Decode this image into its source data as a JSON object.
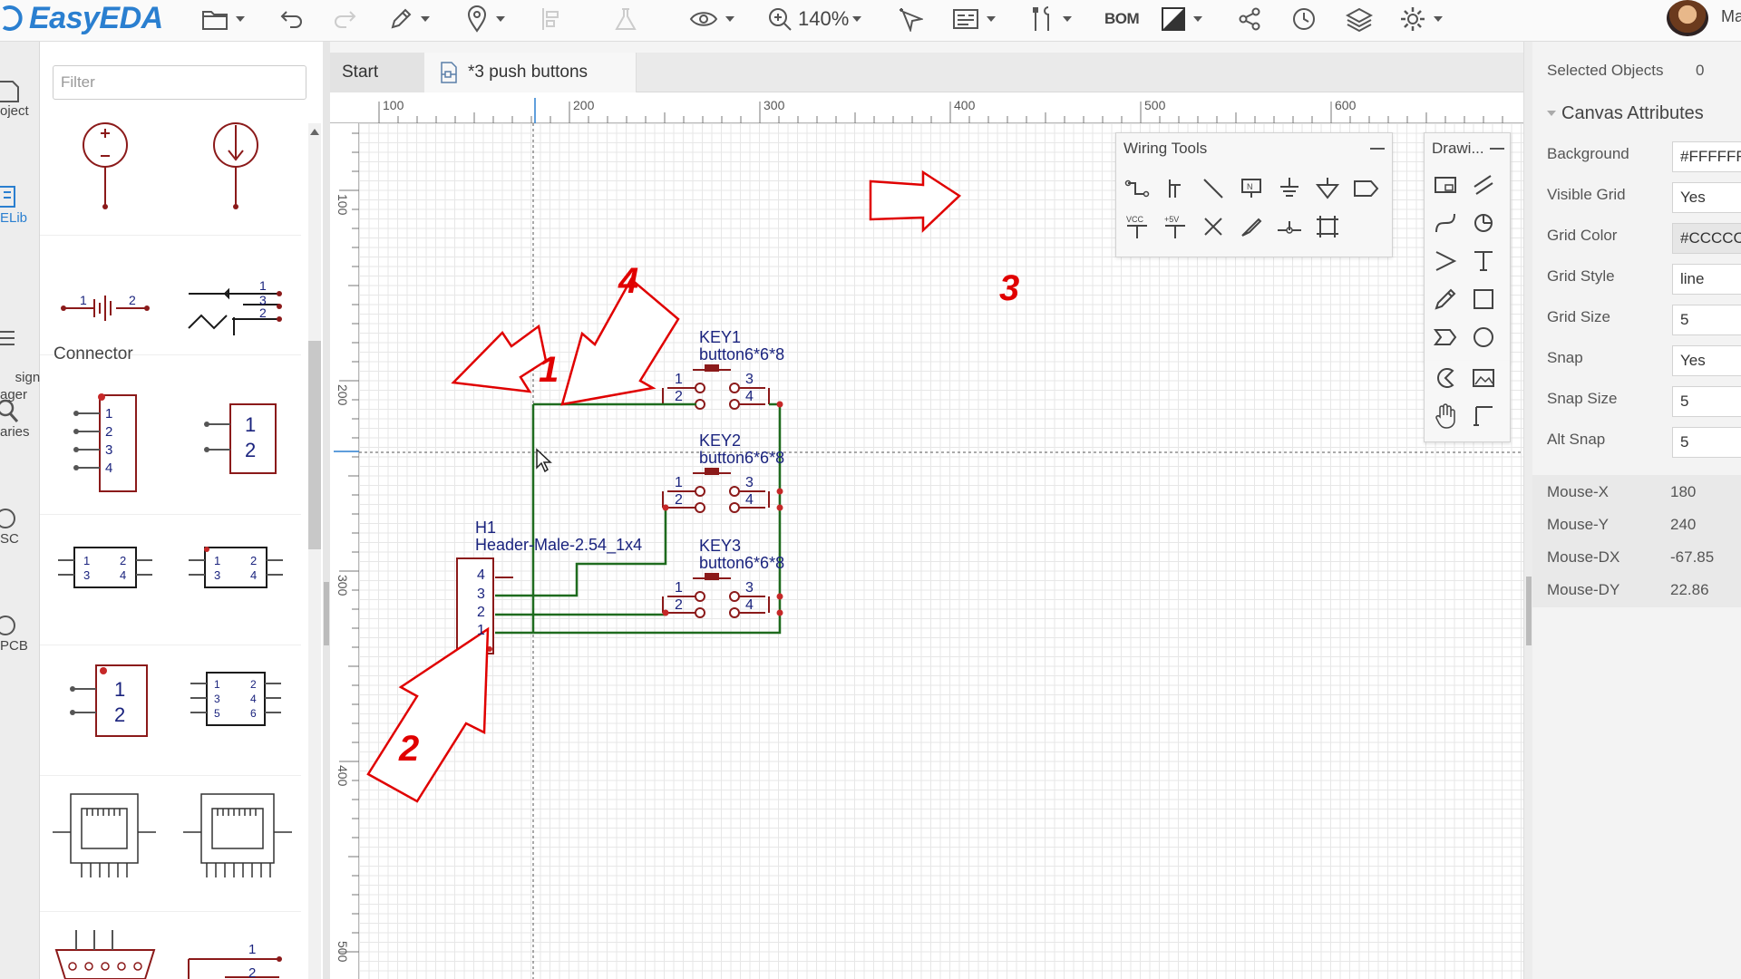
{
  "app": {
    "name": "EasyEDA",
    "user_initial": "Ma"
  },
  "toolbar": {
    "zoom": "140%",
    "bom_label": "BOM"
  },
  "left_nav": [
    "oject",
    "ELib",
    "sign\nager",
    "aries",
    "SC",
    "PCB"
  ],
  "library": {
    "filter_placeholder": "Filter",
    "category": "Connector"
  },
  "tabs": [
    {
      "label": "Start"
    },
    {
      "label": "*3 push buttons"
    }
  ],
  "ruler": {
    "top": [
      "100",
      "200",
      "300",
      "400",
      "500",
      "600"
    ],
    "left": [
      "100",
      "200",
      "300",
      "400",
      "500"
    ]
  },
  "schematic": {
    "components": [
      {
        "ref": "KEY1",
        "value": "button6*6*8",
        "pins": [
          "1",
          "2",
          "3",
          "4"
        ]
      },
      {
        "ref": "KEY2",
        "value": "button6*6*8",
        "pins": [
          "1",
          "2",
          "3",
          "4"
        ]
      },
      {
        "ref": "KEY3",
        "value": "button6*6*8",
        "pins": [
          "1",
          "2",
          "3",
          "4"
        ]
      },
      {
        "ref": "H1",
        "value": "Header-Male-2.54_1x4",
        "pins": [
          "4",
          "3",
          "2",
          "1"
        ]
      }
    ],
    "annotations": [
      "1",
      "2",
      "3",
      "4"
    ]
  },
  "panels": {
    "wiring_tools": {
      "title": "Wiring Tools",
      "vcc": "VCC",
      "p5v": "+5V"
    },
    "drawing_tools": {
      "title": "Drawi..."
    }
  },
  "properties": {
    "selected_label": "Selected Objects",
    "selected_count": "0",
    "section": "Canvas Attributes",
    "attributes": [
      {
        "label": "Background",
        "value": "#FFFFFF"
      },
      {
        "label": "Visible Grid",
        "value": "Yes"
      },
      {
        "label": "Grid Color",
        "value": "#CCCCCC"
      },
      {
        "label": "Grid Style",
        "value": "line"
      },
      {
        "label": "Grid Size",
        "value": "5"
      },
      {
        "label": "Snap",
        "value": "Yes"
      },
      {
        "label": "Snap Size",
        "value": "5"
      },
      {
        "label": "Alt Snap",
        "value": "5"
      }
    ],
    "mouse": [
      {
        "label": "Mouse-X",
        "value": "180"
      },
      {
        "label": "Mouse-Y",
        "value": "240"
      },
      {
        "label": "Mouse-DX",
        "value": "-67.85"
      },
      {
        "label": "Mouse-DY",
        "value": "22.86"
      }
    ]
  },
  "colors": {
    "brand": "#2a7fd0",
    "wire": "#1e6b1e",
    "component": "#8b1a1a",
    "pin_label": "#1a237e",
    "annotation": "#e00000"
  }
}
